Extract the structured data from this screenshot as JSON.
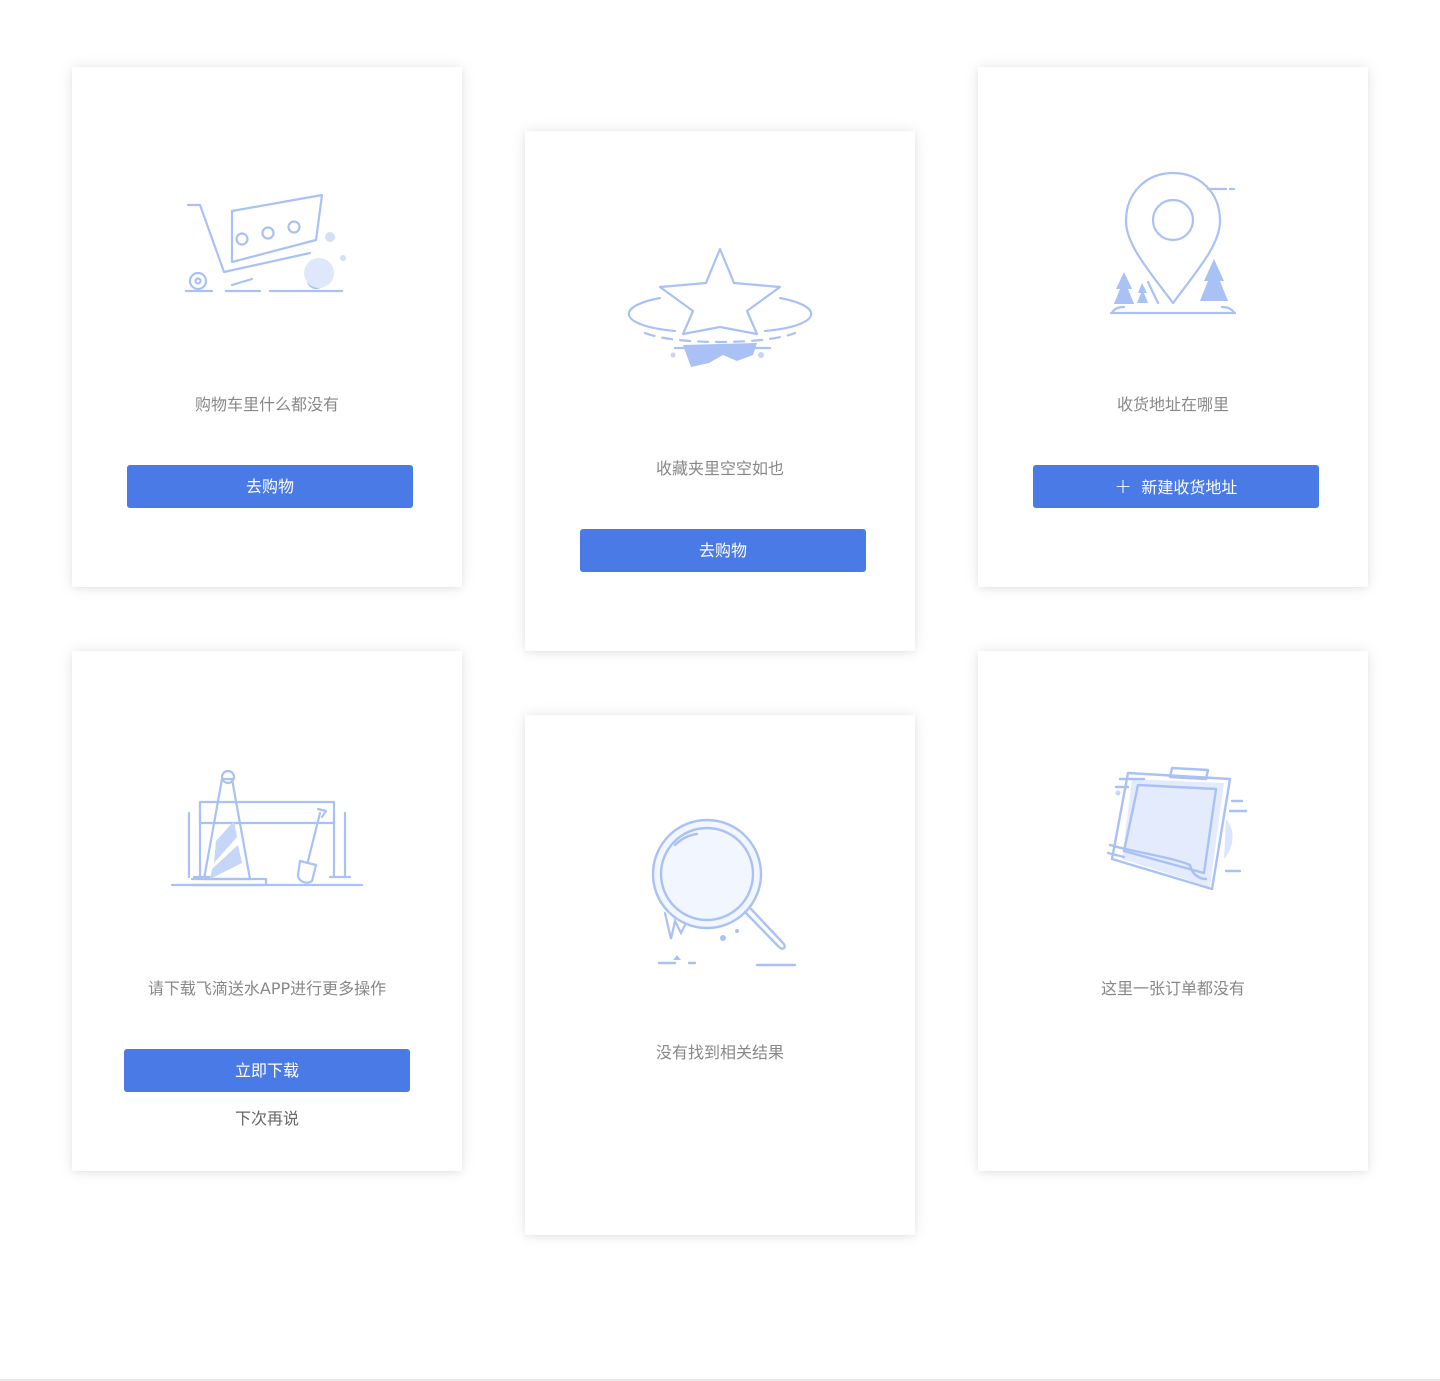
{
  "accent_color": "#4a7ae6",
  "illustration_color": "#a9c1f5",
  "cards": [
    {
      "icon": "shopping-cart-icon",
      "message": "购物车里什么都没有",
      "button_label": "去购物"
    },
    {
      "icon": "star-icon",
      "message": "收藏夹里空空如也",
      "button_label": "去购物"
    },
    {
      "icon": "location-pin-icon",
      "message": "收货地址在哪里",
      "button_icon": "+",
      "button_label": "新建收货地址"
    },
    {
      "icon": "construction-icon",
      "message": "请下载飞滴送水APP进行更多操作",
      "button_label": "立即下载",
      "link_label": "下次再说"
    },
    {
      "icon": "magnifier-icon",
      "message": "没有找到相关结果"
    },
    {
      "icon": "clipboard-icon",
      "message": "这里一张订单都没有"
    }
  ]
}
